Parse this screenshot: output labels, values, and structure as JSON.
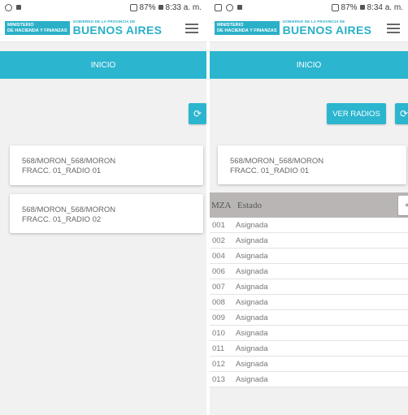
{
  "left": {
    "status": {
      "time_text": "8:33 a. m.",
      "battery": "87%"
    },
    "header": {
      "logo_line1": "MINISTERIO",
      "logo_line2": "DE HACIENDA Y FINANZAS",
      "logo_small": "GOBIERNO DE LA PROVINCIA DE",
      "logo_big": "BUENOS AIRES"
    },
    "nav_title": "INICIO",
    "cards": [
      {
        "line1": "568/MORON_568/MORON",
        "line2": "FRACC. 01_RADIO 01"
      },
      {
        "line1": "568/MORON_568/MORON",
        "line2": "FRACC. 01_RADIO 02"
      }
    ]
  },
  "right": {
    "status": {
      "time_text": "8:34 a. m.",
      "battery": "87%"
    },
    "header": {
      "logo_line1": "MINISTERIO",
      "logo_line2": "DE HACIENDA Y FINANZAS",
      "logo_small": "GOBIERNO DE LA PROVINCIA DE",
      "logo_big": "BUENOS AIRES"
    },
    "nav_title": "INICIO",
    "ver_radios_label": "VER RADIOS",
    "card": {
      "line1": "568/MORON_568/MORON",
      "line2": "FRACC. 01_RADIO 01"
    },
    "table": {
      "col_mza": "MZA",
      "col_estado": "Estado",
      "plus_label": "+",
      "rows": [
        {
          "mza": "001",
          "estado": "Asignada"
        },
        {
          "mza": "002",
          "estado": "Asignada"
        },
        {
          "mza": "004",
          "estado": "Asignada"
        },
        {
          "mza": "006",
          "estado": "Asignada"
        },
        {
          "mza": "007",
          "estado": "Asignada"
        },
        {
          "mza": "008",
          "estado": "Asignada"
        },
        {
          "mza": "009",
          "estado": "Asignada"
        },
        {
          "mza": "010",
          "estado": "Asignada"
        },
        {
          "mza": "011",
          "estado": "Asignada"
        },
        {
          "mza": "012",
          "estado": "Asignada"
        },
        {
          "mza": "013",
          "estado": "Asignada"
        }
      ]
    }
  },
  "icons": {
    "refresh": "refresh-icon",
    "menu": "hamburger-menu-icon"
  },
  "colors": {
    "accent": "#2bb5cf",
    "table_header": "#b9b5b5",
    "background": "#f1f1f1"
  }
}
